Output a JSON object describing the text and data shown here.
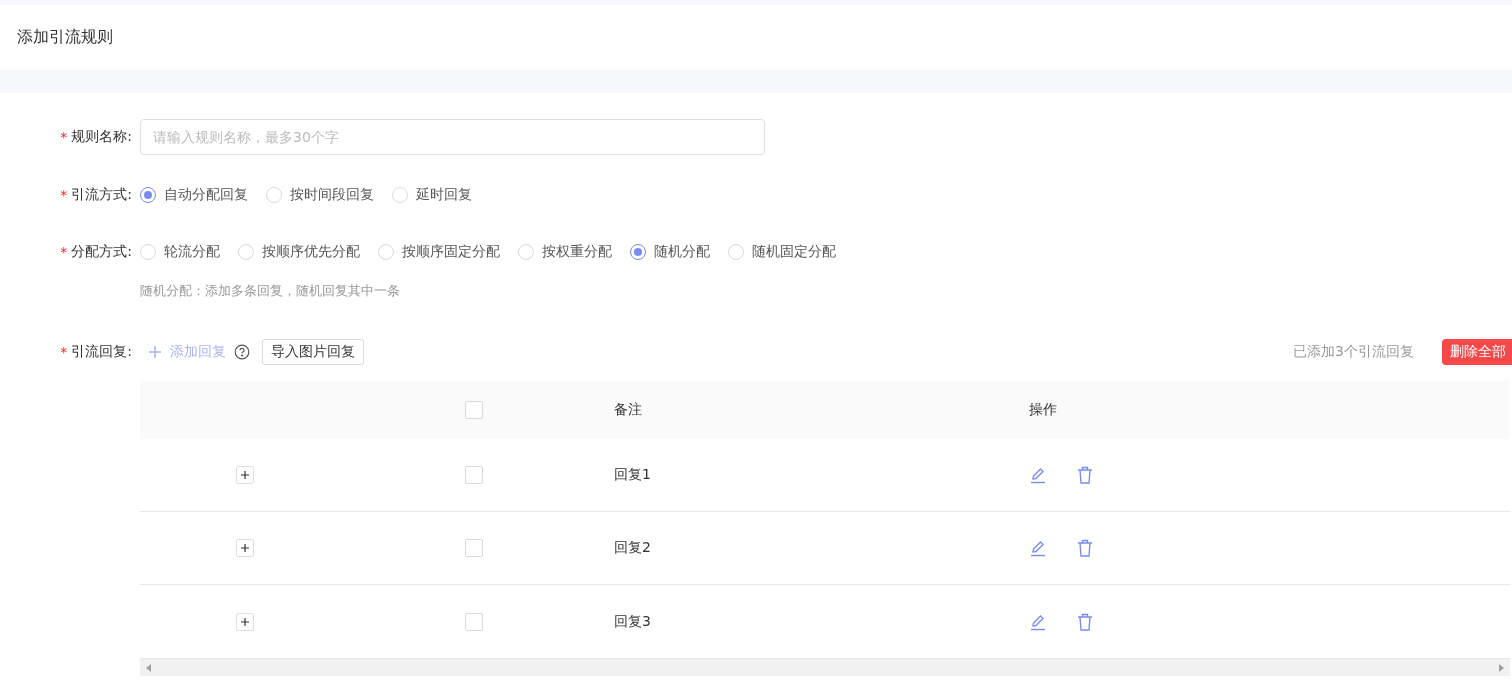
{
  "page_title": "添加引流规则",
  "rule_name": {
    "required_mark": "*",
    "label": "规则名称:",
    "placeholder": "请输入规则名称，最多30个字"
  },
  "flow_mode": {
    "required_mark": "*",
    "label": "引流方式:",
    "options": [
      {
        "label": "自动分配回复",
        "selected": true
      },
      {
        "label": "按时间段回复",
        "selected": false
      },
      {
        "label": "延时回复",
        "selected": false
      }
    ]
  },
  "assign_mode": {
    "required_mark": "*",
    "label": "分配方式:",
    "options": [
      {
        "label": "轮流分配",
        "selected": false
      },
      {
        "label": "按顺序优先分配",
        "selected": false
      },
      {
        "label": "按顺序固定分配",
        "selected": false
      },
      {
        "label": "按权重分配",
        "selected": false
      },
      {
        "label": "随机分配",
        "selected": true
      },
      {
        "label": "随机固定分配",
        "selected": false
      }
    ],
    "hint": "随机分配：添加多条回复，随机回复其中一条"
  },
  "replies": {
    "required_mark": "*",
    "label": "引流回复:",
    "add_link": "添加回复",
    "import_button": "导入图片回复",
    "count_text": "已添加3个引流回复",
    "delete_all_button": "删除全部",
    "table": {
      "header_checked": false,
      "columns": [
        "备注",
        "操作"
      ],
      "rows": [
        {
          "note": "回复1",
          "checked": false
        },
        {
          "note": "回复2",
          "checked": false
        },
        {
          "note": "回复3",
          "checked": false
        }
      ]
    }
  }
}
